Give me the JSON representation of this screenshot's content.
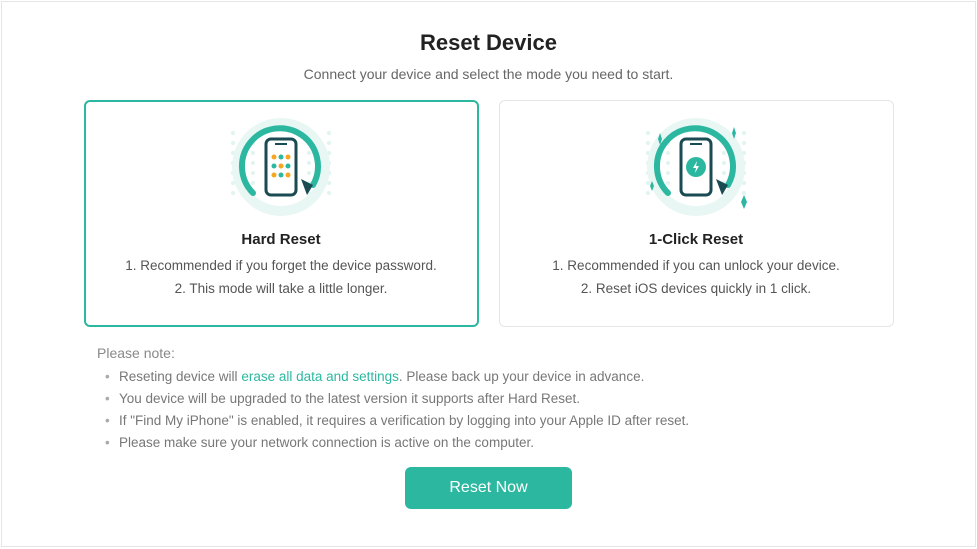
{
  "title": "Reset Device",
  "subtitle": "Connect your device and select the mode you need to start.",
  "cards": {
    "hard": {
      "title": "Hard Reset",
      "line1": "1. Recommended if you forget the device password.",
      "line2": "2. This mode will take a little longer."
    },
    "click": {
      "title": "1-Click Reset",
      "line1": "1. Recommended if you can unlock your device.",
      "line2": "2. Reset iOS devices quickly in 1 click."
    }
  },
  "notes": {
    "heading": "Please note:",
    "items": {
      "n1a": "Reseting device will ",
      "n1b": "erase all data and settings",
      "n1c": ". Please back up your device in advance.",
      "n2": "You device will be upgraded to the latest version it supports after Hard Reset.",
      "n3": "If \"Find My iPhone\" is enabled, it requires a verification by logging into your Apple ID after reset.",
      "n4": "Please make sure your network connection is active on the computer."
    }
  },
  "button": "Reset Now",
  "colors": {
    "accent": "#2cb8a0"
  }
}
